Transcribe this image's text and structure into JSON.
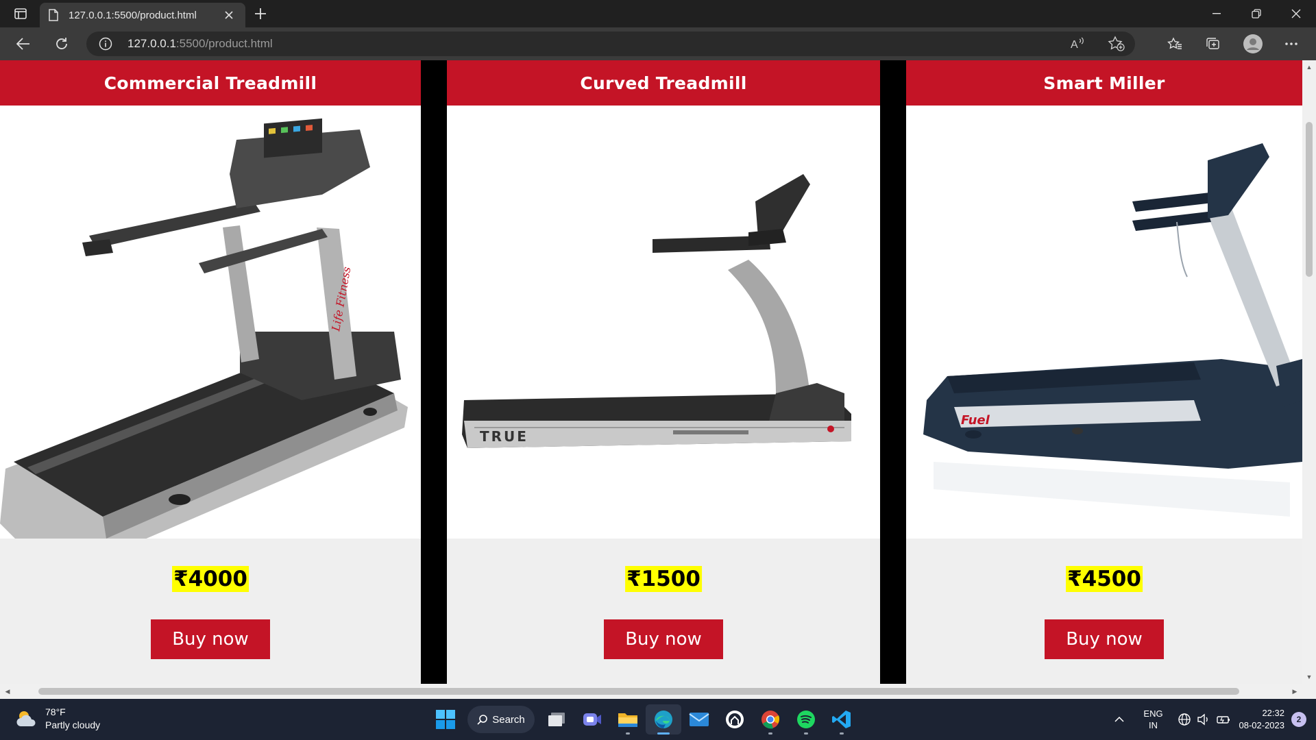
{
  "browser": {
    "tab_title": "127.0.0.1:5500/product.html",
    "url_host": "127.0.0.1",
    "url_rest": ":5500/product.html"
  },
  "products": [
    {
      "name": "Commercial Treadmill",
      "price": "₹4000",
      "button": "Buy now",
      "image_icon": "treadmill-commercial"
    },
    {
      "name": "Curved Treadmill",
      "price": "₹1500",
      "button": "Buy now",
      "image_icon": "treadmill-curved",
      "brand_text": "TRUE"
    },
    {
      "name": "Smart Miller",
      "price": "₹4500",
      "button": "Buy now",
      "image_icon": "treadmill-smart",
      "brand_text": "Fuel"
    }
  ],
  "colors": {
    "header_red": "#c41426",
    "price_highlight": "#ffff00",
    "card_bg": "#efefef"
  },
  "taskbar": {
    "weather_temp": "78°F",
    "weather_desc": "Partly cloudy",
    "search_label": "Search",
    "lang_line1": "ENG",
    "lang_line2": "IN",
    "time": "22:32",
    "date": "08-02-2023",
    "notification_count": "2"
  }
}
